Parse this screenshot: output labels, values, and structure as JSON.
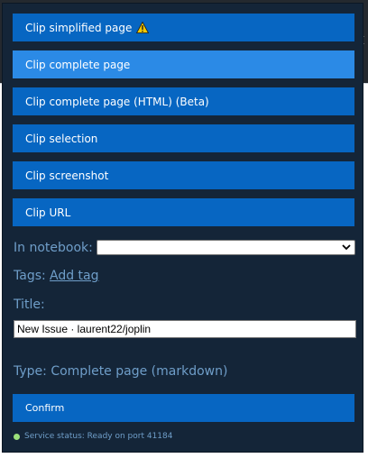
{
  "background_page": {
    "close_glyph": "×"
  },
  "clip_buttons": [
    {
      "label": "Clip simplified page",
      "icon": "warning-icon"
    },
    {
      "label": "Clip complete page"
    },
    {
      "label": "Clip complete page (HTML) (Beta)"
    },
    {
      "label": "Clip selection"
    },
    {
      "label": "Clip screenshot"
    },
    {
      "label": "Clip URL"
    }
  ],
  "notebook": {
    "label": "In notebook:",
    "selected": ""
  },
  "tags": {
    "label": "Tags:",
    "add_link": "Add tag"
  },
  "title": {
    "label": "Title:",
    "value": "New Issue · laurent22/joplin"
  },
  "type_line": "Type: Complete page (markdown)",
  "confirm_label": "Confirm",
  "service_status": {
    "text": "Service status: Ready on port 41184",
    "color": "#9be07a"
  },
  "colors": {
    "popup_bg": "#142538",
    "button_bg": "#0766c2",
    "button_active_bg": "#2b8ae6",
    "label_text": "#6f9ec9",
    "warning": "#f5c800"
  }
}
